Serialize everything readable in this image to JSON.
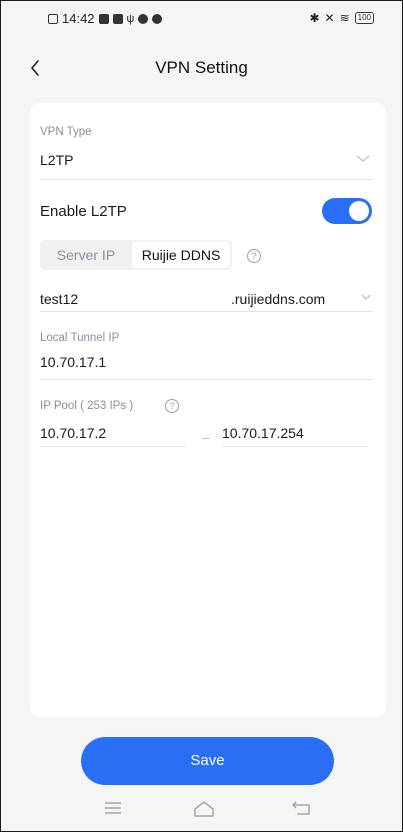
{
  "status_bar": {
    "time": "14:42",
    "battery": "100"
  },
  "header": {
    "title": "VPN Setting"
  },
  "vpn_type": {
    "label": "VPN Type",
    "value": "L2TP"
  },
  "enable": {
    "label": "Enable L2TP",
    "on": true
  },
  "segmented": {
    "options": [
      "Server IP",
      "Ruijie DDNS"
    ],
    "selected": "Ruijie DDNS"
  },
  "ddns": {
    "host": "test12",
    "suffix": ".ruijieddns.com"
  },
  "local_tunnel": {
    "label": "Local Tunnel IP",
    "value": "10.70.17.1"
  },
  "ip_pool": {
    "label": "IP Pool ( 253  IPs )",
    "start": "10.70.17.2",
    "end": "10.70.17.254",
    "separator": "_"
  },
  "footer": {
    "save_label": "Save"
  },
  "colors": {
    "accent": "#2b6ef6",
    "background": "#f4f5f7",
    "card": "#ffffff",
    "label": "#8a8f98"
  }
}
